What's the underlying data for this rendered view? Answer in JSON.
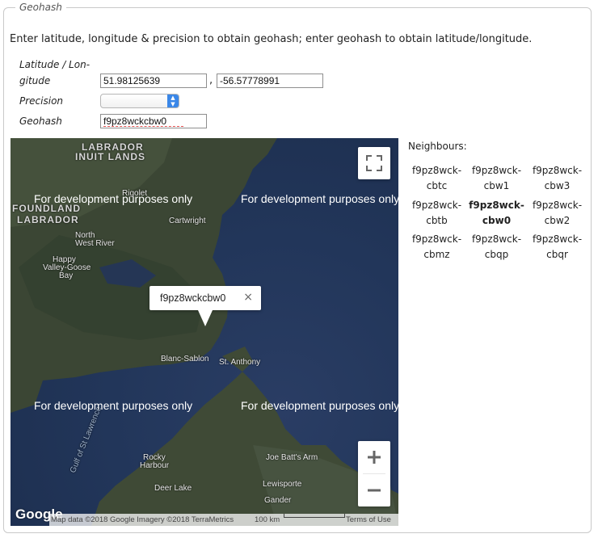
{
  "legend": "Geohash",
  "intro": "Enter latitude, longitude & precision to obtain geohash; enter geohash to obtain latitude/longitude.",
  "form": {
    "latlon_label_1": "Latitude / Lon-",
    "latlon_label_2": "gitude",
    "latitude": "51.98125639",
    "comma": ",",
    "longitude": "-56.57778991",
    "precision_label": "Precision",
    "precision_value": "",
    "geohash_label": "Geohash",
    "geohash": "f9pz8wckcbw0"
  },
  "map": {
    "dev_notice": "For development purposes only",
    "infowindow_text": "f9pz8wckcbw0",
    "close_glyph": "×",
    "zoom_in": "+",
    "zoom_out": "−",
    "google_logo": "Google",
    "attribution": "Map data ©2018 Google Imagery ©2018 TerraMetrics",
    "scale_label": "100 km",
    "terms": "Terms of Use",
    "regions": {
      "labrador_inuit_1": "LABRADOR",
      "labrador_inuit_2": "INUIT LANDS",
      "nfld_1": "FOUNDLAND",
      "nfld_2": "LABRADOR"
    },
    "places": {
      "rigolet": "Rigolet",
      "cartwright": "Cartwright",
      "north_west_river_1": "North",
      "north_west_river_2": "West River",
      "happy_valley_1": "Happy",
      "happy_valley_2": "Valley-Goose",
      "happy_valley_3": "Bay",
      "blanc_sablon": "Blanc-Sablon",
      "st_anthony": "St. Anthony",
      "gulf": "Gulf of St Lawrence",
      "rocky_harbour_1": "Rocky",
      "rocky_harbour_2": "Harbour",
      "joe_batts": "Joe Batt's Arm",
      "lewisporte": "Lewisporte",
      "deer_lake": "Deer Lake",
      "gander": "Gander"
    },
    "colors": {
      "water": "#22365a",
      "land": "#3e4a35",
      "tint": "#ffffff"
    }
  },
  "neighbours": {
    "label": "Neighbours:",
    "cells": [
      {
        "line1": "f9pz8wck-",
        "line2": "cbtc"
      },
      {
        "line1": "f9pz8wck-",
        "line2": "cbw1"
      },
      {
        "line1": "f9pz8wck-",
        "line2": "cbw3"
      },
      {
        "line1": "f9pz8wck-",
        "line2": "cbtb"
      },
      {
        "line1": "f9pz8wck-",
        "line2": "cbw0"
      },
      {
        "line1": "f9pz8wck-",
        "line2": "cbw2"
      },
      {
        "line1": "f9pz8wck-",
        "line2": "cbmz"
      },
      {
        "line1": "f9pz8wck-",
        "line2": "cbqp"
      },
      {
        "line1": "f9pz8wck-",
        "line2": "cbqr"
      }
    ]
  }
}
